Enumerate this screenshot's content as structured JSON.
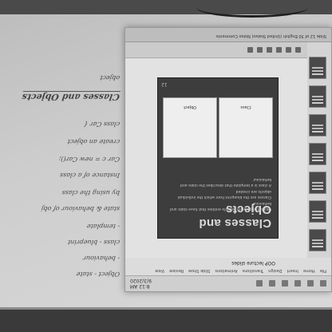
{
  "taskbar": {
    "clock": "8:12 AM\n9/3/2020",
    "icons": [
      "start-icon",
      "search-icon",
      "task-view-icon",
      "explorer-icon",
      "powerpoint-icon",
      "chrome-icon"
    ]
  },
  "ribbon": {
    "tabs": [
      "File",
      "Home",
      "Insert",
      "Design",
      "Transitions",
      "Animations",
      "Slide Show",
      "Review",
      "View"
    ],
    "document_title": "OOP lecture slides"
  },
  "slide": {
    "title": "Classes and Objects",
    "bullets": [
      "Objects in Java are real life entities that have state and behaviour",
      "Classes are the blueprint from which the individual objects are created",
      "A class is a template that describes the state and behaviour"
    ],
    "picture_captions": [
      "Class",
      "Object"
    ],
    "number": "12"
  },
  "statusbar": {
    "text": "Slide 12 of 30    English (United States)    Notes    Comments"
  },
  "whiteboard": {
    "title": "Classes and Objects",
    "lines": [
      "Object - state",
      "- behaviour",
      "class - blueprint",
      "- template",
      "state & behaviour of obj",
      "by using the class",
      "Instance of a class",
      "Car c = new Car();",
      "create an object",
      "class Car {",
      "object"
    ]
  }
}
